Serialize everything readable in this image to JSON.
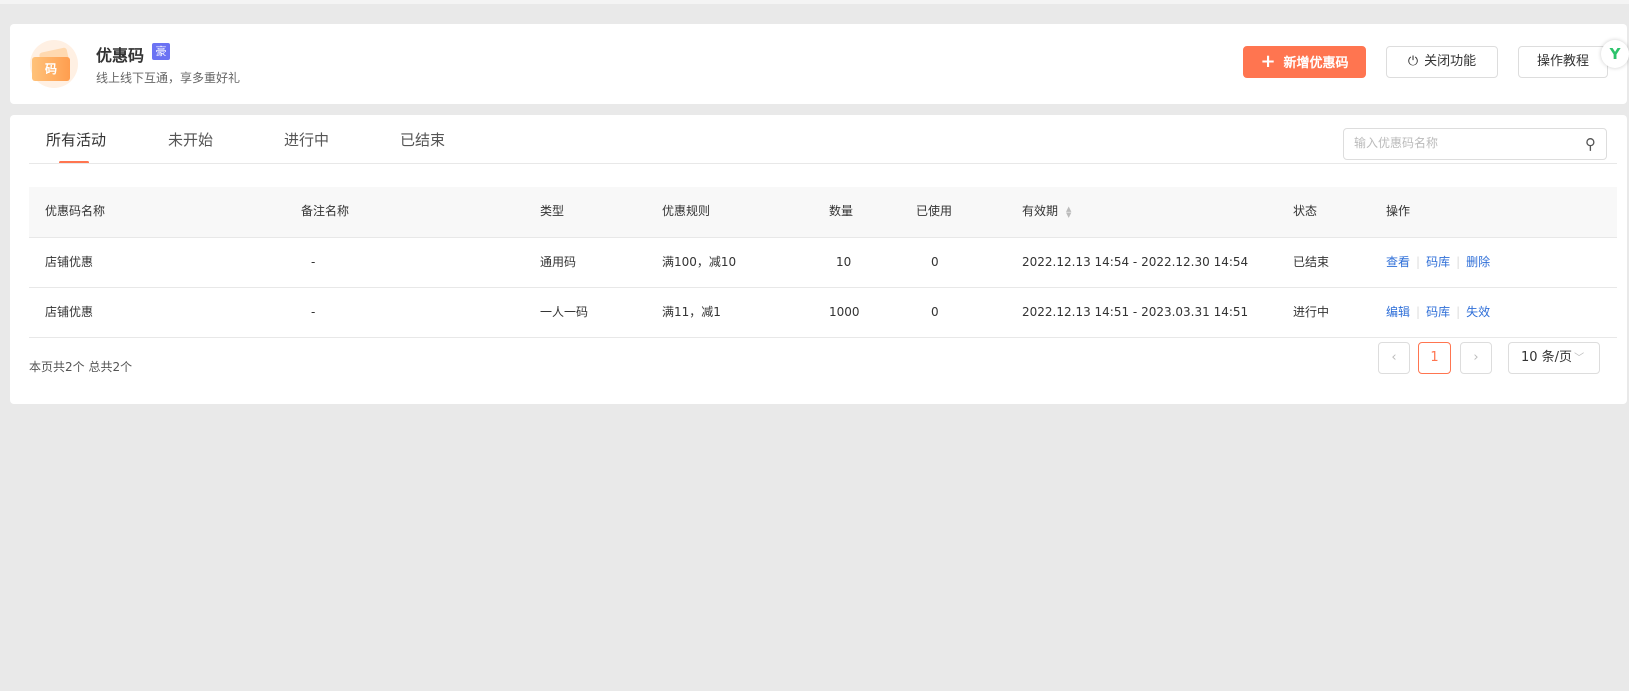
{
  "header": {
    "logo_text": "码",
    "title": "优惠码",
    "badge": "豪",
    "subtitle": "线上线下互通，享多重好礼",
    "add_button": "新增优惠码",
    "close_button": "关闭功能",
    "tutorial_button": "操作教程",
    "fab_text": "Y"
  },
  "tabs": [
    "所有活动",
    "未开始",
    "进行中",
    "已结束"
  ],
  "search": {
    "placeholder": "输入优惠码名称",
    "value": ""
  },
  "table": {
    "columns": [
      "优惠码名称",
      "备注名称",
      "类型",
      "优惠规则",
      "数量",
      "已使用",
      "有效期",
      "状态",
      "操作"
    ],
    "rows": [
      {
        "name": "店铺优惠",
        "remark": "-",
        "type": "通用码",
        "rule": "满100，减10",
        "qty": "10",
        "used": "0",
        "period": "2022.12.13 14:54 - 2022.12.30 14:54",
        "status": "已结束",
        "actions": [
          "查看",
          "码库",
          "删除"
        ]
      },
      {
        "name": "店铺优惠",
        "remark": "-",
        "type": "一人一码",
        "rule": "满11，减1",
        "qty": "1000",
        "used": "0",
        "period": "2022.12.13 14:51 - 2023.03.31 14:51",
        "status": "进行中",
        "actions": [
          "编辑",
          "码库",
          "失效"
        ]
      }
    ]
  },
  "footer": {
    "summary": "本页共2个 总共2个",
    "current_page": "1",
    "page_size": "10 条/页"
  },
  "colors": {
    "accent": "#ff7550",
    "link": "#2f6fd8"
  }
}
